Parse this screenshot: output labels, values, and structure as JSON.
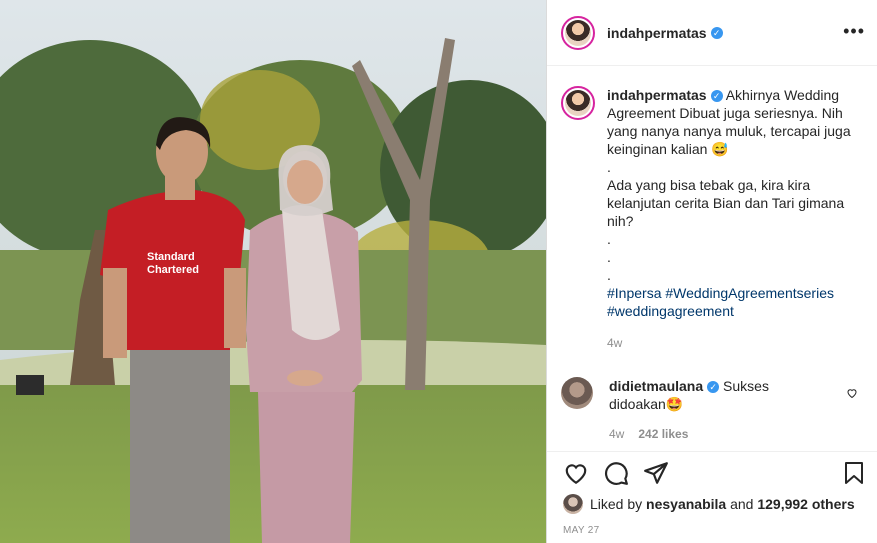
{
  "post": {
    "username": "indahpermatas",
    "menu_icon": "more-dots-icon",
    "caption": {
      "line1": "Akhirnya Wedding Agreement Dibuat juga seriesnya. Nih yang nanya nanya muluk, tercapai juga keinginan kalian 😅",
      "dot1": ".",
      "line2": "Ada yang bisa tebak ga, kira kira kelanjutan cerita Bian dan Tari gimana nih?",
      "dot2": ".",
      "dot3": ".",
      "dot4": ".",
      "hashtags1": "#Inpersa #WeddingAgreementseries",
      "hashtags2": "#weddingagreement"
    },
    "caption_time": "4w",
    "comment": {
      "username": "didietmaulana",
      "text": "Sukses didoakan🤩",
      "time": "4w",
      "likes": "242 likes"
    },
    "liked_by": {
      "prefix": "Liked by",
      "user": "nesyanabila",
      "middle": "and",
      "count": "129,992 others"
    },
    "date": "MAY 27"
  },
  "photo": {
    "jersey_sponsor_line1": "Standard",
    "jersey_sponsor_line2": "Chartered"
  }
}
